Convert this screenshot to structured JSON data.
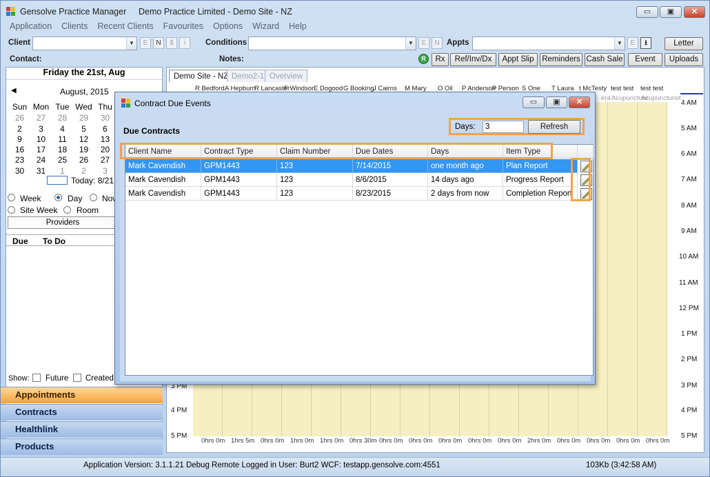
{
  "app": {
    "name": "Gensolve Practice Manager",
    "context": "Demo Practice Limited - Demo Site - NZ",
    "win_buttons": {
      "minimize": "▭",
      "restore": "▣",
      "close": "✕"
    }
  },
  "menu": [
    "Application",
    "Clients",
    "Recent Clients",
    "Favourites",
    "Options",
    "Wizard",
    "Help"
  ],
  "toolbar": {
    "client_label": "Client",
    "conditions_label": "Conditions",
    "appts_label": "Appts",
    "contact_label": "Contact:",
    "notes_label": "Notes:",
    "mini_e": "E",
    "mini_n": "N",
    "mini_s": "$",
    "mini_i": "i",
    "letter_btn": "Letter",
    "uploads_btn": "Uploads",
    "rx_btn": "Rx",
    "refinv_btn": "Ref/Inv/Dx",
    "apptslip_btn": "Appt Slip",
    "reminders_btn": "Reminders",
    "cashsale_btn": "Cash Sale",
    "event_btn": "Event",
    "download_icon": "download-icon",
    "r_icon": "R"
  },
  "calendar": {
    "date_heading": "Friday the 21st, Aug",
    "month": "August, 2015",
    "days": [
      "Sun",
      "Mon",
      "Tue",
      "Wed",
      "Thu"
    ],
    "weeks": [
      [
        "26",
        "27",
        "28",
        "29",
        "30"
      ],
      [
        "2",
        "3",
        "4",
        "5",
        "6"
      ],
      [
        "9",
        "10",
        "11",
        "12",
        "13"
      ],
      [
        "16",
        "17",
        "18",
        "19",
        "20"
      ],
      [
        "23",
        "24",
        "25",
        "26",
        "27"
      ],
      [
        "30",
        "31",
        "1",
        "2",
        "3"
      ]
    ],
    "today": "Today: 8/21"
  },
  "view": {
    "week": "Week",
    "day": "Day",
    "now": "Now",
    "site_week": "Site Week",
    "room": "Room",
    "providers": "Providers",
    "due_col": "Due",
    "todo_col": "To Do",
    "show_label": "Show:",
    "future": "Future",
    "created": "Created"
  },
  "nav": [
    "Appointments",
    "Contracts",
    "Healthlink",
    "Products"
  ],
  "schedule": {
    "tabs": [
      "Demo Site - NZ",
      "Demo2-1",
      "Overview"
    ],
    "providers": [
      "R Bedford",
      "A Hepburn",
      "R Lancaster",
      "F Windsor",
      "E Dogood",
      "G Booking",
      "J Cairns",
      "M Mary",
      "O Oil",
      "P Anderson",
      "P Person",
      "S One",
      "T Laura",
      "t McTesty",
      "test test",
      "test test"
    ],
    "provider_sub": [
      "era",
      "Acupuncture",
      "Acupuncturist"
    ],
    "right_times": [
      "4 AM",
      "5 AM",
      "6 AM",
      "7 AM",
      "8 AM",
      "9 AM",
      "10 AM",
      "11 AM",
      "12 PM",
      "1 PM",
      "2 PM",
      "3 PM",
      "4 PM",
      "5 PM"
    ],
    "left_times": [
      "3 PM",
      "4 PM",
      "5 PM"
    ],
    "hours": [
      "0hrs 0m",
      "1hrs 5m",
      "0hrs 0m",
      "1hrs 0m",
      "1hrs 0m",
      "0hrs 30m",
      "0hrs 0m",
      "0hrs 0m",
      "0hrs 0m",
      "0hrs 0m",
      "0hrs 0m",
      "2hrs 0m",
      "0hrs 0m",
      "0hrs 0m",
      "0hrs 0m",
      "0hrs 0m"
    ]
  },
  "status": {
    "version": "Application Version: 3.1.1.21 Debug Remote  Logged in User: Burt2 WCF: testapp.gensolve.com:4551",
    "memory": "103Kb  (3:42:58 AM)"
  },
  "dialog": {
    "title": "Contract Due Events",
    "heading": "Due Contracts",
    "days_label": "Days:",
    "days_value": "3",
    "refresh": "Refresh",
    "columns": [
      "Client Name",
      "Contract Type",
      "Claim Number",
      "Due Dates",
      "Days",
      "Item Type"
    ],
    "rows": [
      {
        "client": "Mark Cavendish",
        "contract": "GPM1443",
        "claim": "123",
        "due": "7/14/2015",
        "days": "one month ago",
        "item": "Plan Report"
      },
      {
        "client": "Mark Cavendish",
        "contract": "GPM1443",
        "claim": "123",
        "due": "8/6/2015",
        "days": "14 days ago",
        "item": "Progress Report"
      },
      {
        "client": "Mark Cavendish",
        "contract": "GPM1443",
        "claim": "123",
        "due": "8/23/2015",
        "days": "2 days from now",
        "item": "Completion Report"
      }
    ]
  }
}
